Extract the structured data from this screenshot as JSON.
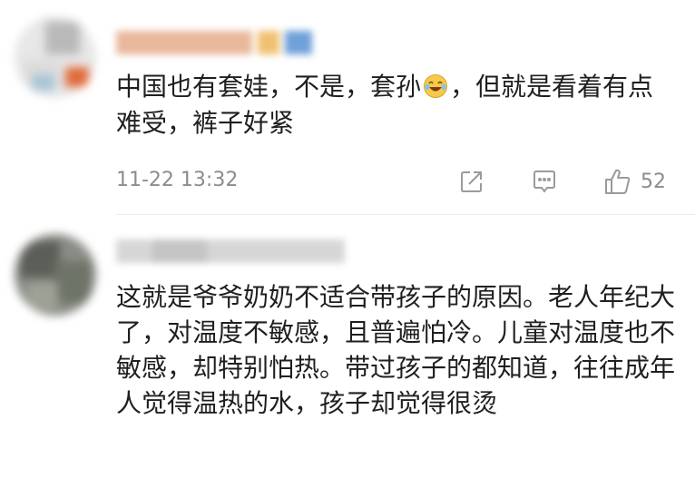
{
  "comments": [
    {
      "text_before_emoji": "中国也有套娃，不是，套孙",
      "emoji_icon": "laughing-tears-emoji",
      "text_after_emoji": "，但就是看着有点难受，裤子好紧",
      "timestamp": "11-22 13:32",
      "likes": "52",
      "actions": [
        "share-icon",
        "reply-icon",
        "thumbs-up-icon"
      ]
    },
    {
      "text": "这就是爷爷奶奶不适合带孩子的原因。老人年纪大了，对温度不敏感，且普遍怕冷。儿童对温度也不敏感，却特别怕热。带过孩子的都知道，往往成年人觉得温热的水，孩子却觉得很烫"
    }
  ],
  "colors": {
    "text": "#1f1f1f",
    "meta": "#8c8c8c",
    "icon": "#9a9a9a",
    "divider": "#ececec"
  }
}
